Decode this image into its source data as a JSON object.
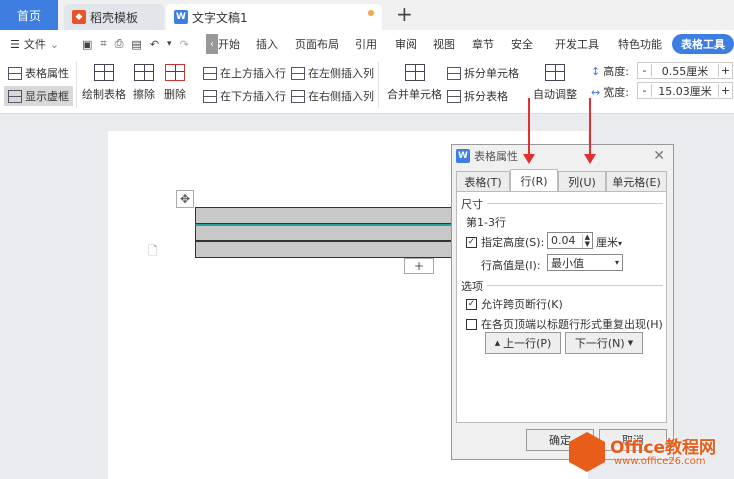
{
  "tabs": {
    "home": "首页",
    "template": "稻壳模板",
    "doc": "文字文稿1",
    "new": "+"
  },
  "menu": {
    "file": "文件",
    "items": [
      "开始",
      "插入",
      "页面布局",
      "引用",
      "审阅",
      "视图",
      "章节",
      "安全",
      "开发工具",
      "特色功能"
    ],
    "table_tools": "表格工具"
  },
  "ribbon": {
    "table_props": "表格属性",
    "show_gridlines": "显示虚框",
    "draw_table": "绘制表格",
    "erase": "擦除",
    "delete": "删除",
    "ins_above": "在上方插入行",
    "ins_below": "在下方插入行",
    "ins_left": "在左侧插入列",
    "ins_right": "在右侧插入列",
    "merge": "合并单元格",
    "split_cell": "拆分单元格",
    "split_table": "拆分表格",
    "auto_fit": "自动调整",
    "height_label": "高度:",
    "height_value": "0.55厘米",
    "width_label": "宽度:",
    "width_value": "15.03厘米",
    "minus": "-",
    "plus": "+"
  },
  "dialog": {
    "title": "表格属性",
    "tabs": [
      "表格(T)",
      "行(R)",
      "列(U)",
      "单元格(E)"
    ],
    "size_group": "尺寸",
    "rows_label": "第1-3行",
    "specify_height": "指定高度(S):",
    "height_value": "0.04",
    "unit": "厘米",
    "row_height_is": "行高值是(I):",
    "row_height_mode": "最小值",
    "options_group": "选项",
    "allow_break": "允许跨页断行(K)",
    "repeat_header": "在各页顶端以标题行形式重复出现(H)",
    "prev_row": "上一行(P)",
    "next_row": "下一行(N)",
    "ok": "确定",
    "cancel": "取消"
  },
  "watermark": {
    "brand": "Office教程网",
    "url": "www.office26.com"
  },
  "colors": {
    "accent": "#3d7ee0",
    "arrow": "#e03030",
    "brand": "#e85d1a"
  }
}
